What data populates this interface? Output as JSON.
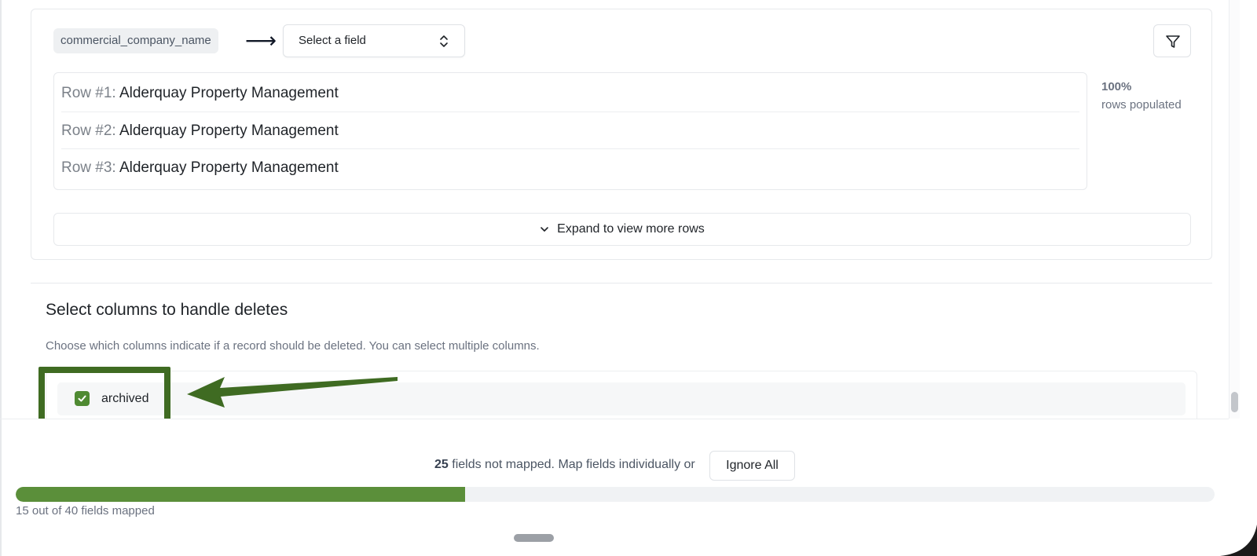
{
  "mapping": {
    "source_column": "commercial_company_name",
    "arrow": "⟶",
    "target_select": {
      "value": "Select a field"
    },
    "filter_icon": "filter-icon",
    "rows": [
      {
        "prefix": "Row #1: ",
        "value": "Alderquay Property Management"
      },
      {
        "prefix": "Row #2: ",
        "value": "Alderquay Property Management"
      },
      {
        "prefix": "Row #3: ",
        "value": "Alderquay Property Management"
      }
    ],
    "populated_percent": "100%",
    "populated_label": "rows populated",
    "expand_label": "Expand to view more rows"
  },
  "deletes": {
    "title": "Select columns to handle deletes",
    "description": "Choose which columns indicate if a record should be deleted. You can select multiple columns.",
    "columns": [
      {
        "label": "archived",
        "checked": true
      }
    ]
  },
  "footer": {
    "unmapped_count": "25",
    "unmapped_text": " fields not mapped. Map fields individually or",
    "ignore_all_label": "Ignore All",
    "progress_caption": "15 out of 40 fields mapped",
    "mapped": 15,
    "total": 40
  },
  "colors": {
    "accent_green": "#5b8f3a",
    "annotation_green": "#3f6b22",
    "checkbox_green": "#4f8a32"
  }
}
